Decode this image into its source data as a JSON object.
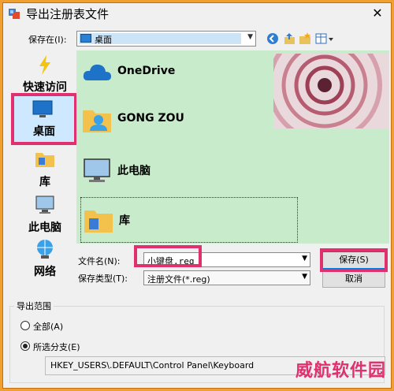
{
  "window": {
    "title": "导出注册表文件",
    "close": "✕"
  },
  "toolbar": {
    "savein_label": "保存在(I):",
    "savein_value": "桌面",
    "back": "◀",
    "up": "⬆",
    "newfolder": "✱",
    "view": "▦▾"
  },
  "places": [
    {
      "label": "快速访问",
      "icon": "lightning-icon"
    },
    {
      "label": "桌面",
      "icon": "desktop-icon",
      "selected": true
    },
    {
      "label": "库",
      "icon": "library-folder-icon"
    },
    {
      "label": "此电脑",
      "icon": "computer-icon"
    },
    {
      "label": "网络",
      "icon": "network-icon"
    }
  ],
  "files": [
    {
      "name": "OneDrive",
      "icon": "cloud-icon"
    },
    {
      "name": "GONG ZOU",
      "icon": "user-folder-icon"
    },
    {
      "name": "此电脑",
      "icon": "computer-icon"
    },
    {
      "name": "库",
      "icon": "library-folder-icon"
    }
  ],
  "form": {
    "filename_label": "文件名(N):",
    "filename_value": "小键盘.reg",
    "filetype_label": "保存类型(T):",
    "filetype_value": "注册文件(*.reg)",
    "save_label": "保存(S)",
    "cancel_label": "取消"
  },
  "range": {
    "legend": "导出范围",
    "all_label": "全部(A)",
    "branch_label": "所选分支(E)",
    "selected": "branch",
    "branch_path": "HKEY_USERS\\.DEFAULT\\Control Panel\\Keyboard"
  },
  "watermark": "威航软件园",
  "colors": {
    "highlight": "#e0306e",
    "list_bg": "#c8ebcb",
    "frame": "#f0a030"
  }
}
